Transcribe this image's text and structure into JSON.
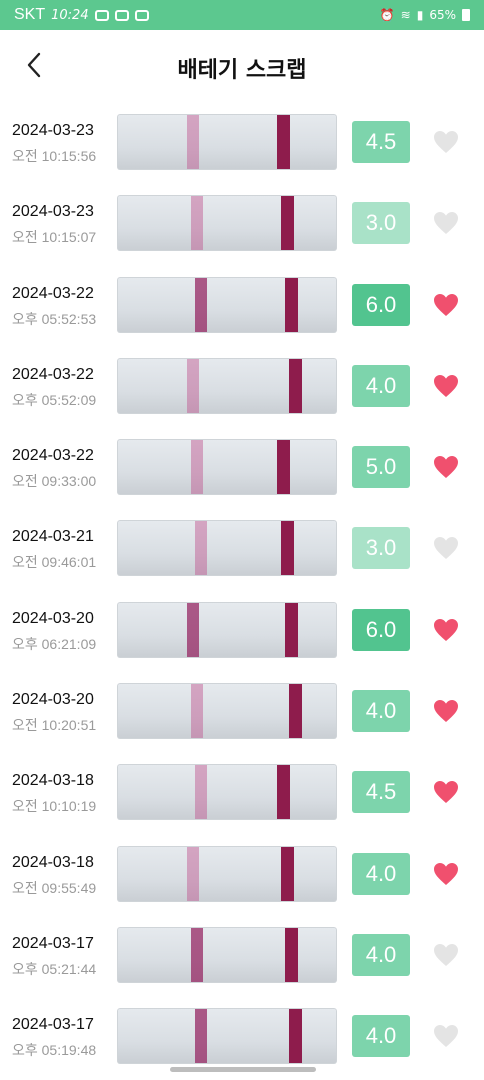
{
  "status_bar": {
    "carrier": "SKT",
    "time": "10:24",
    "battery": "65%"
  },
  "header": {
    "title": "배테기 스크랩",
    "back_icon": "chevron-left-icon"
  },
  "colors": {
    "status_bar": "#5cc88f",
    "score_high": "#52c48f",
    "score_mid": "#7dd4ac",
    "score_low": "#a9e2c8",
    "heart_on": "#f0506e",
    "heart_off": "#e4e4e4"
  },
  "scrap_items": [
    {
      "date": "2024-03-23",
      "time": "오전 10:15:56",
      "score": "4.5",
      "level": "mid",
      "favorite": false,
      "control": "faint",
      "test": "strong"
    },
    {
      "date": "2024-03-23",
      "time": "오전 10:15:07",
      "score": "3.0",
      "level": "low",
      "favorite": false,
      "control": "faint",
      "test": "strong"
    },
    {
      "date": "2024-03-22",
      "time": "오후 05:52:53",
      "score": "6.0",
      "level": "high",
      "favorite": true,
      "control": "medium",
      "test": "strong"
    },
    {
      "date": "2024-03-22",
      "time": "오후 05:52:09",
      "score": "4.0",
      "level": "mid",
      "favorite": true,
      "control": "faint",
      "test": "strong"
    },
    {
      "date": "2024-03-22",
      "time": "오전 09:33:00",
      "score": "5.0",
      "level": "mid",
      "favorite": true,
      "control": "faint",
      "test": "strong"
    },
    {
      "date": "2024-03-21",
      "time": "오전 09:46:01",
      "score": "3.0",
      "level": "low",
      "favorite": false,
      "control": "faint",
      "test": "strong"
    },
    {
      "date": "2024-03-20",
      "time": "오후 06:21:09",
      "score": "6.0",
      "level": "high",
      "favorite": true,
      "control": "medium",
      "test": "strong"
    },
    {
      "date": "2024-03-20",
      "time": "오전 10:20:51",
      "score": "4.0",
      "level": "mid",
      "favorite": true,
      "control": "faint",
      "test": "strong"
    },
    {
      "date": "2024-03-18",
      "time": "오전 10:10:19",
      "score": "4.5",
      "level": "mid",
      "favorite": true,
      "control": "faint",
      "test": "strong"
    },
    {
      "date": "2024-03-18",
      "time": "오전 09:55:49",
      "score": "4.0",
      "level": "mid",
      "favorite": true,
      "control": "faint",
      "test": "strong"
    },
    {
      "date": "2024-03-17",
      "time": "오후 05:21:44",
      "score": "4.0",
      "level": "mid",
      "favorite": false,
      "control": "medium",
      "test": "strong"
    },
    {
      "date": "2024-03-17",
      "time": "오후 05:19:48",
      "score": "4.0",
      "level": "mid",
      "favorite": false,
      "control": "medium",
      "test": "strong"
    }
  ]
}
